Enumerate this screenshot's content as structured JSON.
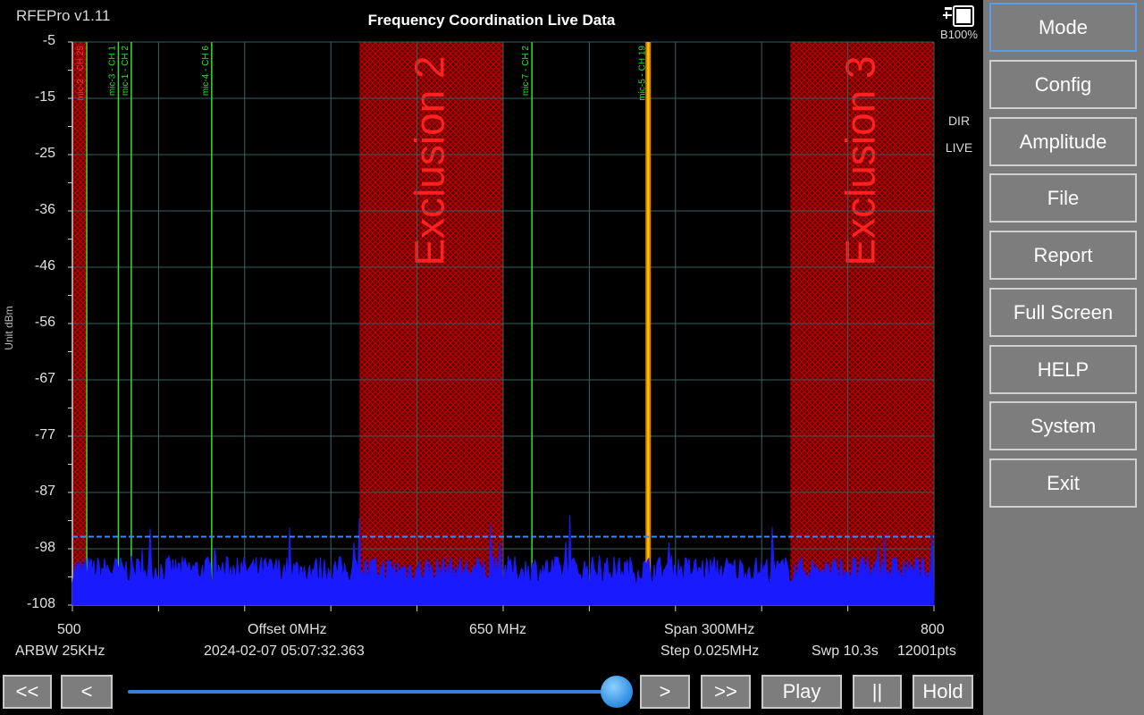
{
  "app": {
    "title": "RFEPro v1.11"
  },
  "chart_title": "Frequency Coordination Live Data",
  "battery": {
    "label": "B100%",
    "icon": "battery-charging-icon"
  },
  "status": {
    "dir": "DIR",
    "live": "LIVE"
  },
  "chart_data": {
    "type": "line",
    "title": "Frequency Coordination Live Data",
    "ylabel": "Unit dBm",
    "xlabel": "",
    "xlim": [
      500,
      800
    ],
    "ylim": [
      -108,
      -5
    ],
    "y_ticks": [
      "-5",
      "-15",
      "-25",
      "-36",
      "-46",
      "-56",
      "-67",
      "-77",
      "-87",
      "-98",
      "-108"
    ],
    "x_tick_labels": {
      "left": "500",
      "center": "650 MHz",
      "right": "800"
    },
    "threshold_dbm": -95.5,
    "noise_floor_dbm": [
      -104,
      -99
    ],
    "exclusions": [
      {
        "name": "",
        "from_mhz": 500,
        "to_mhz": 505
      },
      {
        "name": "Exclusion 2",
        "from_mhz": 600,
        "to_mhz": 650
      },
      {
        "name": "Exclusion 3",
        "from_mhz": 750,
        "to_mhz": 800
      }
    ],
    "markers": [
      {
        "label": "mic-2 - CH 25",
        "mhz": 505,
        "color": "#ff3030"
      },
      {
        "label": "mic-3 - CH 1",
        "mhz": 516,
        "color": "#30e030"
      },
      {
        "label": "mic-1 - CH 2",
        "mhz": 520.5,
        "color": "#30e030"
      },
      {
        "label": "mic-4 - CH 6",
        "mhz": 548.5,
        "color": "#30e030"
      },
      {
        "label": "mic-7 - CH 2",
        "mhz": 660,
        "color": "#30e030"
      },
      {
        "label": "mic-5 - CH 19",
        "mhz": 700.5,
        "color": "#30e030"
      }
    ]
  },
  "info": {
    "offset": "Offset 0MHz",
    "span": "Span 300MHz",
    "rbw": "ARBW 25KHz",
    "timestamp": "2024-02-07 05:07:32.363",
    "step": "Step 0.025MHz",
    "sweep": "Swp 10.3s",
    "points": "12001pts"
  },
  "menu": [
    "Mode",
    "Config",
    "Amplitude",
    "File",
    "Report",
    "Full Screen",
    "HELP",
    "System",
    "Exit"
  ],
  "nav": {
    "first": "<<",
    "prev": "<",
    "next": ">",
    "last": ">>",
    "play": "Play",
    "pause": "||",
    "hold": "Hold"
  },
  "colors": {
    "trace": "#1a1aff",
    "threshold": "#3a8cff",
    "exclusion": "#c00000",
    "grid": "#3a6060",
    "sidebar": "#7a7a7a"
  }
}
